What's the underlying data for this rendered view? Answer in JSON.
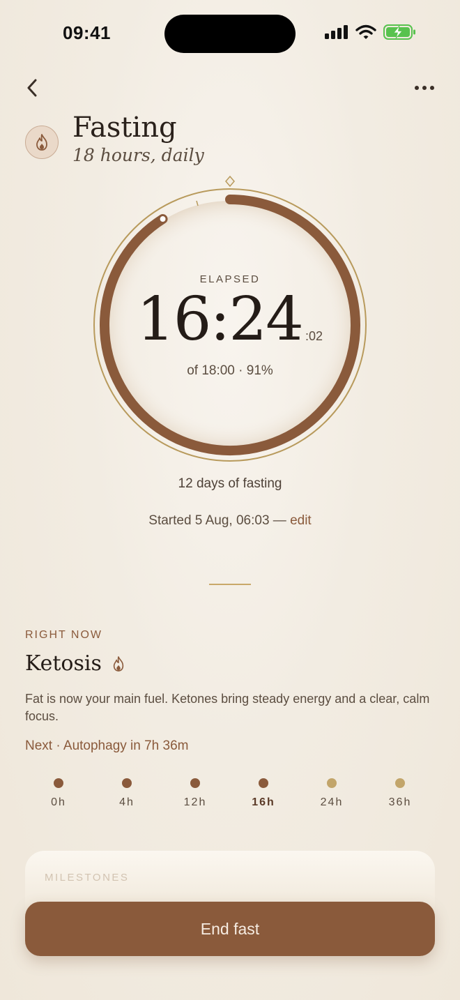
{
  "status_bar": {
    "time": "09:41"
  },
  "header": {
    "title": "Fasting",
    "subtitle": "18 hours, daily"
  },
  "timer": {
    "label": "ELAPSED",
    "value": "16:24",
    "seconds": ":02",
    "target_text": "of 18:00 · 91%",
    "progress": 0.91
  },
  "streak_text": "12 days of fasting",
  "started": {
    "text": "Started 5 Aug, 06:03 — ",
    "edit_label": "edit"
  },
  "right_now": {
    "section_label": "RIGHT NOW",
    "phase": "Ketosis",
    "description": "Fat is now your main fuel. Ketones bring steady energy and a clear, calm focus.",
    "next": "Next · Autophagy in 7h 36m",
    "timeline": [
      {
        "label": "0h",
        "state": "done"
      },
      {
        "label": "4h",
        "state": "done"
      },
      {
        "label": "12h",
        "state": "done"
      },
      {
        "label": "16h",
        "state": "current"
      },
      {
        "label": "24h",
        "state": "upcoming"
      },
      {
        "label": "36h",
        "state": "upcoming"
      }
    ]
  },
  "milestones": {
    "label": "MILESTONES"
  },
  "end_button": {
    "label": "End fast"
  },
  "colors": {
    "accent": "#8a5a3b",
    "gold": "#b89a5c",
    "upcoming_dot": "#c2a56a",
    "text": "#2a211b"
  },
  "icons": {
    "back": "chevron-left-icon",
    "more": "more-horizontal-icon",
    "header": "flame-icon",
    "phase": "flame-icon"
  }
}
